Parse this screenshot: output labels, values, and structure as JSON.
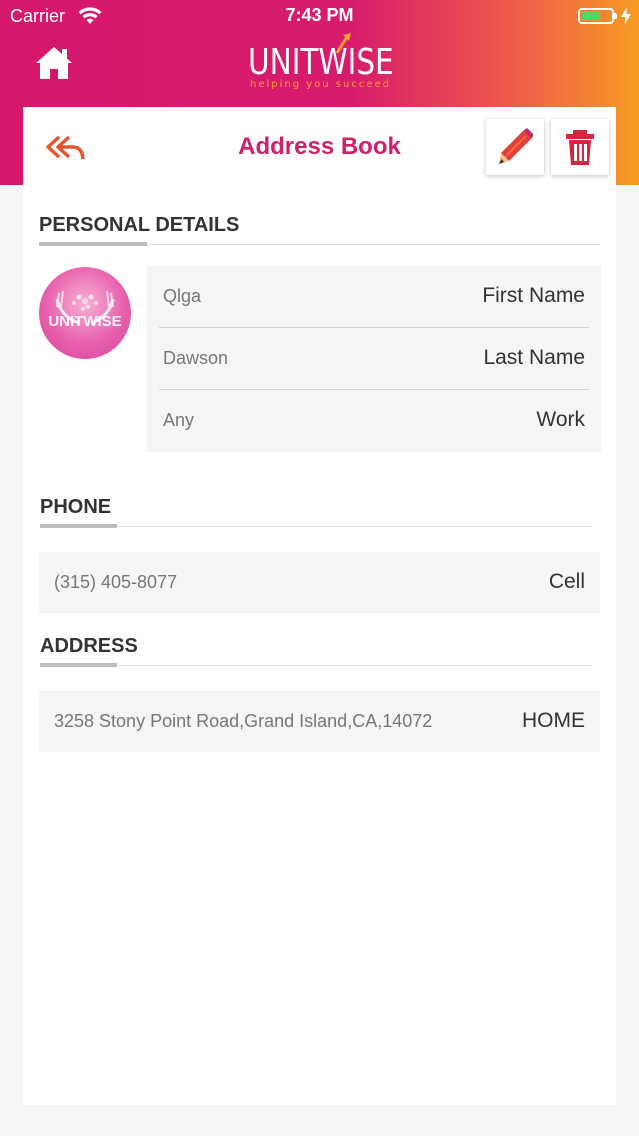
{
  "status_bar": {
    "carrier": "Carrier",
    "time": "7:43 PM",
    "battery_level": 0.6,
    "battery_color": "#4cd964"
  },
  "header": {
    "home_icon": "home-icon",
    "logo_text": "UNITWISE",
    "logo_tagline": "helping you succeed",
    "gradient_colors": [
      "#d6186c",
      "#ee5a4a",
      "#f89a22"
    ]
  },
  "titlebar": {
    "back_icon": "reply-all-icon",
    "title": "Address Book",
    "title_color": "#d21f69",
    "edit_icon": "pencil-icon",
    "delete_icon": "trash-icon"
  },
  "personal_details": {
    "heading": "PERSONAL DETAILS",
    "avatar_text": "UNITWISE",
    "rows": [
      {
        "value": "Qlga",
        "label": "First Name"
      },
      {
        "value": "Dawson",
        "label": "Last Name"
      },
      {
        "value": "Any",
        "label": "Work"
      }
    ]
  },
  "phone": {
    "heading": "PHONE",
    "items": [
      {
        "value": "(315) 405-8077",
        "label": "Cell"
      }
    ]
  },
  "address": {
    "heading": "ADDRESS",
    "items": [
      {
        "value": "3258 Stony Point Road,Grand Island,CA,14072",
        "label": "HOME"
      }
    ]
  }
}
